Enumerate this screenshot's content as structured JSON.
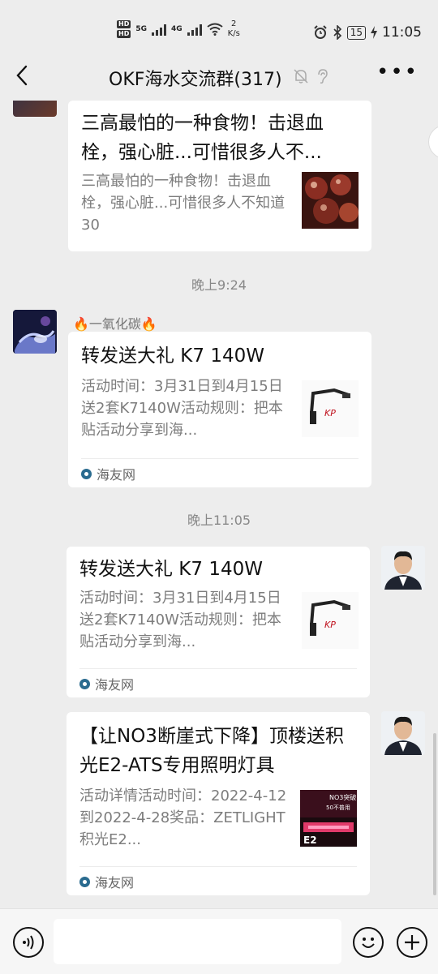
{
  "status": {
    "network1": "5G",
    "network2": "4G",
    "speed_value": "2",
    "speed_unit": "K/s",
    "battery": "15",
    "time": "11:05"
  },
  "header": {
    "title": "OKF海水交流群(317)"
  },
  "messages": [
    {
      "card": {
        "title": "三高最怕的一种食物！击退血栓，强心脏...可惜很多人不...",
        "desc": "三高最怕的一种食物！击退血栓，强心脏...可惜很多人不知道30"
      }
    },
    {
      "time": "晚上9:24"
    },
    {
      "sender": "🔥一氧化碳🔥",
      "card": {
        "title": "转发送大礼 K7 140W",
        "desc": "活动时间：3月31日到4月15日送2套K7140W活动规则：把本贴活动分享到海...",
        "source": "海友网"
      }
    },
    {
      "time": "晚上11:05"
    },
    {
      "card": {
        "title": "转发送大礼 K7 140W",
        "desc": "活动时间：3月31日到4月15日送2套K7140W活动规则：把本贴活动分享到海...",
        "source": "海友网"
      }
    },
    {
      "card": {
        "title": "【让NO3断崖式下降】顶楼送积光E2-ATS专用照明灯具",
        "desc": "活动详情活动时间：2022-4-12到2022-4-28奖品：ZETLIGHT积光E2...",
        "source": "海友网",
        "thumb_text1": "NO3突破",
        "thumb_text2": "50不普用"
      }
    }
  ],
  "colors": {
    "bg": "#ededed",
    "card": "#ffffff",
    "text_secondary": "#7d7d7d",
    "brand_logo": "#c0121e"
  },
  "icons": [
    "back-arrow-icon",
    "mute-bell-icon",
    "ear-icon",
    "more-dots-icon",
    "voice-icon",
    "emoji-icon",
    "plus-icon"
  ]
}
